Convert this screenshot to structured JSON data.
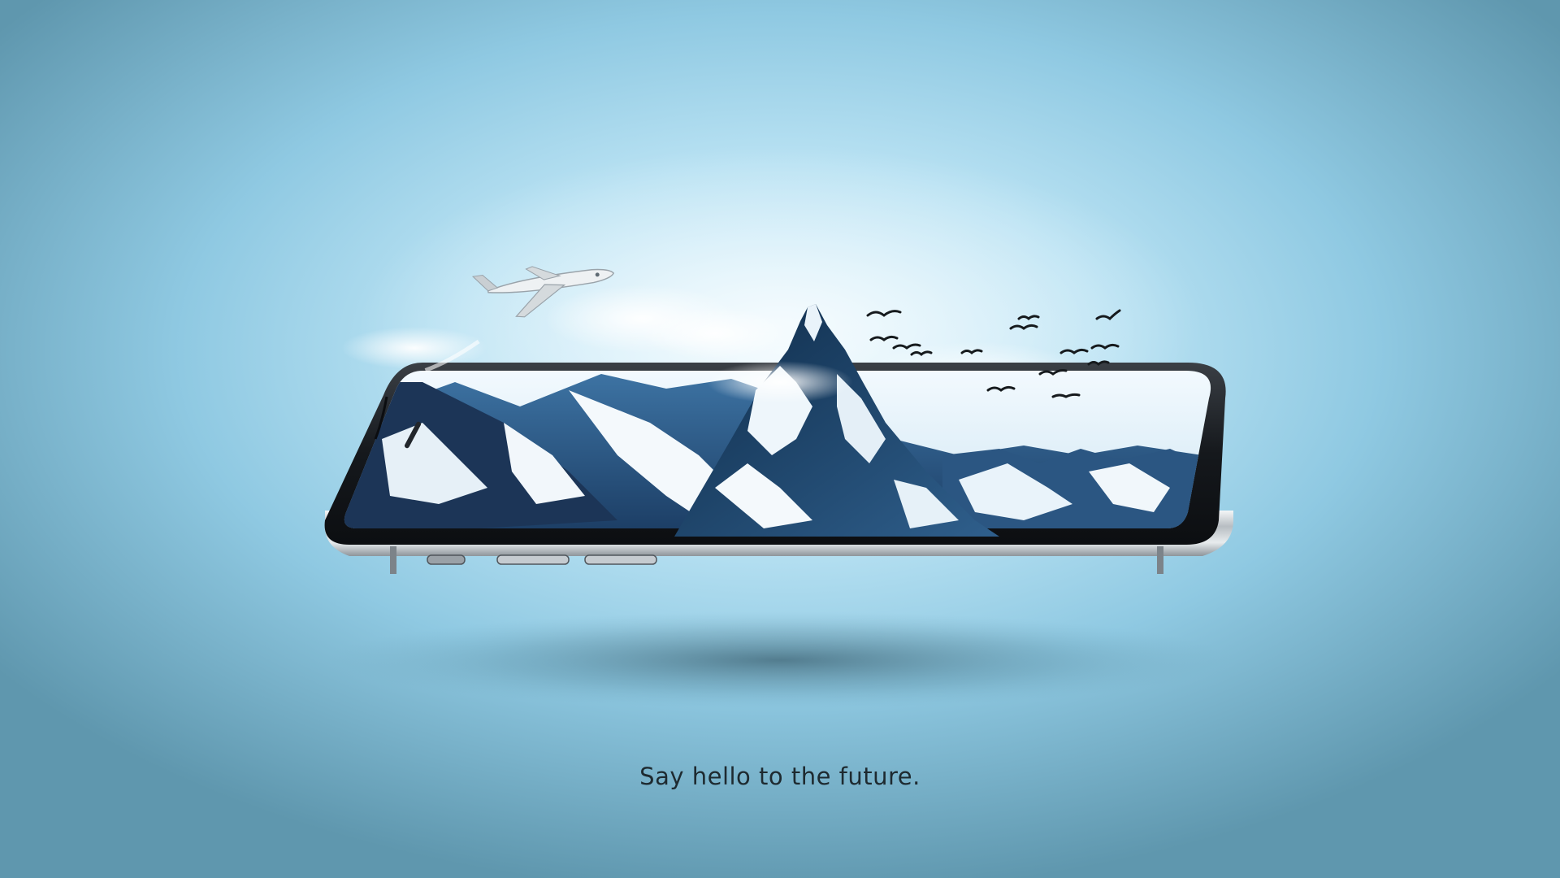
{
  "tagline": "Say hello to the future.",
  "scene": {
    "subject": "smartphone",
    "screen_content": "snowy mountain peak",
    "elements": [
      "airplane",
      "birds",
      "clouds"
    ]
  },
  "colors": {
    "background_center": "#e2f5fd",
    "background_edge": "#5f97ae",
    "tagline_text": "#1e2a30",
    "phone_frame": "#1a1d21"
  }
}
